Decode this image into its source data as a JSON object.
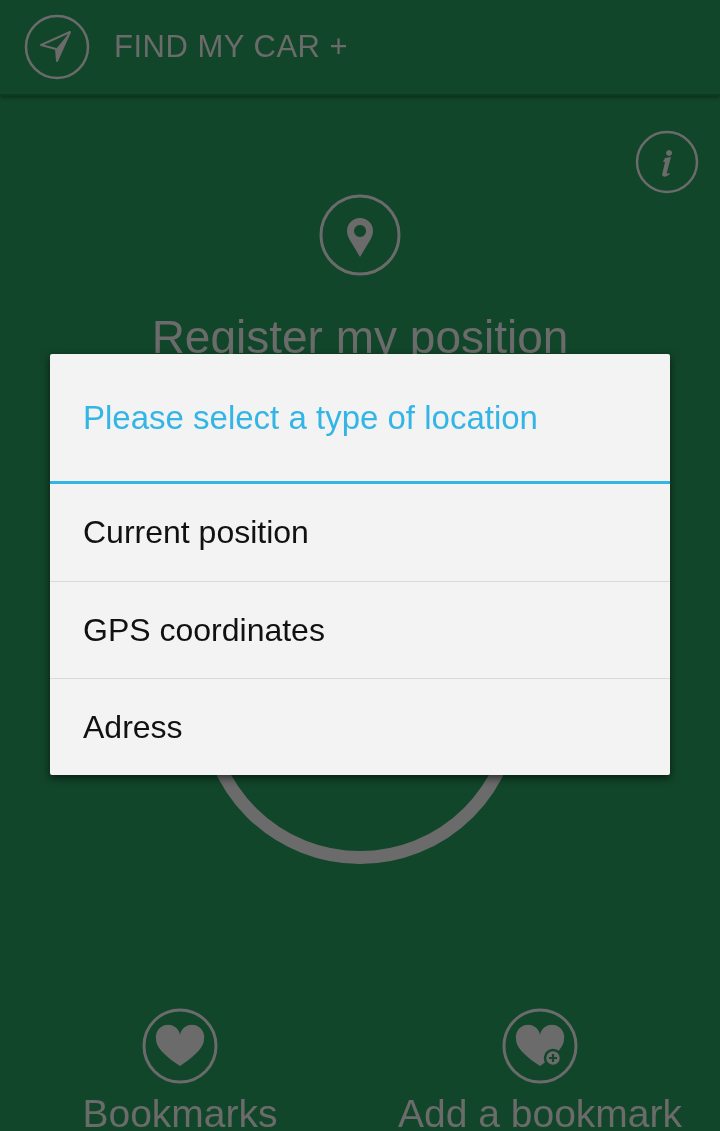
{
  "header": {
    "title": "FIND MY CAR +"
  },
  "register": {
    "label": "Register my position"
  },
  "dialog": {
    "title": "Please select a type of location",
    "options": [
      {
        "label": "Current position"
      },
      {
        "label": "GPS coordinates"
      },
      {
        "label": "Adress"
      }
    ]
  },
  "actions": [
    {
      "kind": "bookmarks",
      "label": "Bookmarks"
    },
    {
      "kind": "add-bookmark",
      "label": "Add a bookmark"
    }
  ]
}
